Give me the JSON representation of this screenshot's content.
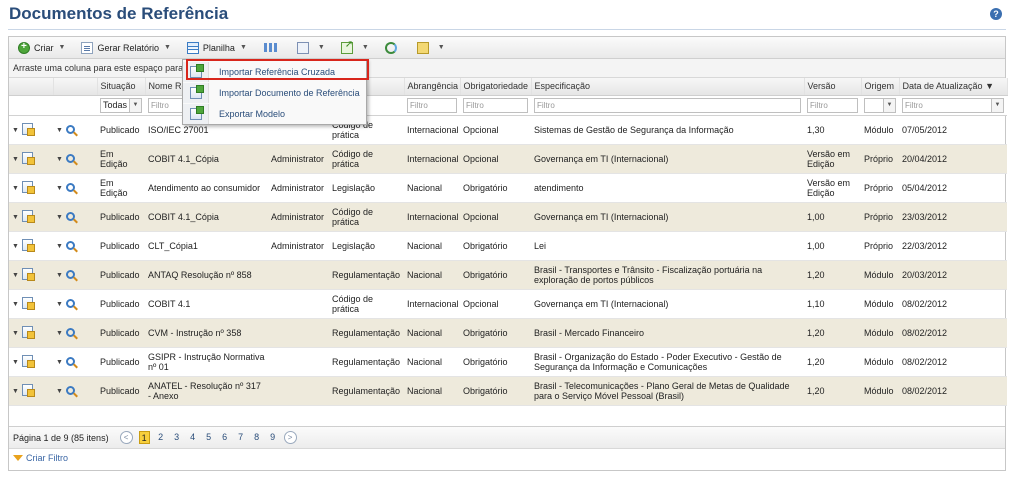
{
  "page": {
    "title": "Documentos de Referência",
    "help_icon": "help-icon"
  },
  "toolbar": {
    "create_label": "Criar",
    "report_label": "Gerar Relatório",
    "sheet_label": "Planilha"
  },
  "group_hint": "Arraste uma coluna para este espaço para",
  "columns": {
    "situacao": "Situação",
    "nome": "Nome Re",
    "abrangencia": "Abrangência",
    "obrigatoriedade": "Obrigatoriedade",
    "especificacao": "Especificação",
    "versao": "Versão",
    "origem": "Origem",
    "data": "Data de Atualização"
  },
  "filters": {
    "situacao_value": "Todas",
    "placeholder": "Filtro"
  },
  "dropdown": {
    "items": [
      "Importar Referência Cruzada",
      "Importar Documento de Referência",
      "Exportar Modelo"
    ]
  },
  "rows": [
    {
      "situacao": "Publicado",
      "nome": "ISO/IEC 27001",
      "autor": "",
      "tipo": "Código de prática",
      "abrangencia": "Internacional",
      "obrigatoriedade": "Opcional",
      "especificacao": "Sistemas de Gestão de Segurança da Informação",
      "versao": "1,30",
      "origem": "Módulo",
      "data": "07/05/2012"
    },
    {
      "situacao": "Em Edição",
      "nome": "COBIT 4.1_Cópia",
      "autor": "Administrator",
      "tipo": "Código de prática",
      "abrangencia": "Internacional",
      "obrigatoriedade": "Opcional",
      "especificacao": "Governança em TI (Internacional)",
      "versao": "Versão em Edição",
      "origem": "Próprio",
      "data": "20/04/2012"
    },
    {
      "situacao": "Em Edição",
      "nome": "Atendimento ao consumidor",
      "autor": "Administrator",
      "tipo": "Legislação",
      "abrangencia": "Nacional",
      "obrigatoriedade": "Obrigatório",
      "especificacao": "atendimento",
      "versao": "Versão em Edição",
      "origem": "Próprio",
      "data": "05/04/2012"
    },
    {
      "situacao": "Publicado",
      "nome": "COBIT 4.1_Cópia",
      "autor": "Administrator",
      "tipo": "Código de prática",
      "abrangencia": "Internacional",
      "obrigatoriedade": "Opcional",
      "especificacao": "Governança em TI (Internacional)",
      "versao": "1,00",
      "origem": "Próprio",
      "data": "23/03/2012"
    },
    {
      "situacao": "Publicado",
      "nome": "CLT_Cópia1",
      "autor": "Administrator",
      "tipo": "Legislação",
      "abrangencia": "Nacional",
      "obrigatoriedade": "Obrigatório",
      "especificacao": "Lei",
      "versao": "1,00",
      "origem": "Próprio",
      "data": "22/03/2012"
    },
    {
      "situacao": "Publicado",
      "nome": "ANTAQ Resolução nº 858",
      "autor": "",
      "tipo": "Regulamentação",
      "abrangencia": "Nacional",
      "obrigatoriedade": "Obrigatório",
      "especificacao": "Brasil - Transportes e Trânsito - Fiscalização portuária na exploração de portos públicos",
      "versao": "1,20",
      "origem": "Módulo",
      "data": "20/03/2012"
    },
    {
      "situacao": "Publicado",
      "nome": "COBIT 4.1",
      "autor": "",
      "tipo": "Código de prática",
      "abrangencia": "Internacional",
      "obrigatoriedade": "Opcional",
      "especificacao": "Governança em TI (Internacional)",
      "versao": "1,10",
      "origem": "Módulo",
      "data": "08/02/2012"
    },
    {
      "situacao": "Publicado",
      "nome": "CVM - Instrução nº 358",
      "autor": "",
      "tipo": "Regulamentação",
      "abrangencia": "Nacional",
      "obrigatoriedade": "Obrigatório",
      "especificacao": "Brasil - Mercado Financeiro",
      "versao": "1,20",
      "origem": "Módulo",
      "data": "08/02/2012"
    },
    {
      "situacao": "Publicado",
      "nome": "GSIPR - Instrução Normativa nº 01",
      "autor": "",
      "tipo": "Regulamentação",
      "abrangencia": "Nacional",
      "obrigatoriedade": "Obrigatório",
      "especificacao": "Brasil - Organização do Estado - Poder Executivo - Gestão de Segurança da Informação e Comunicações",
      "versao": "1,20",
      "origem": "Módulo",
      "data": "08/02/2012"
    },
    {
      "situacao": "Publicado",
      "nome": "ANATEL - Resolução nº 317 - Anexo",
      "autor": "",
      "tipo": "Regulamentação",
      "abrangencia": "Nacional",
      "obrigatoriedade": "Obrigatório",
      "especificacao": "Brasil - Telecomunicações - Plano Geral de Metas de Qualidade para o Serviço Móvel Pessoal (Brasil)",
      "versao": "1,20",
      "origem": "Módulo",
      "data": "08/02/2012"
    }
  ],
  "pager": {
    "info": "Página 1 de 9 (85 itens)",
    "pages": [
      "1",
      "2",
      "3",
      "4",
      "5",
      "6",
      "7",
      "8",
      "9"
    ],
    "prev": "<",
    "next": ">"
  },
  "create_filter": "Criar Filtro",
  "colors": {
    "title": "#2a4d7a",
    "alt_row": "#eeeadc",
    "published": "#8a6d00",
    "highlight": "#d8261c"
  }
}
